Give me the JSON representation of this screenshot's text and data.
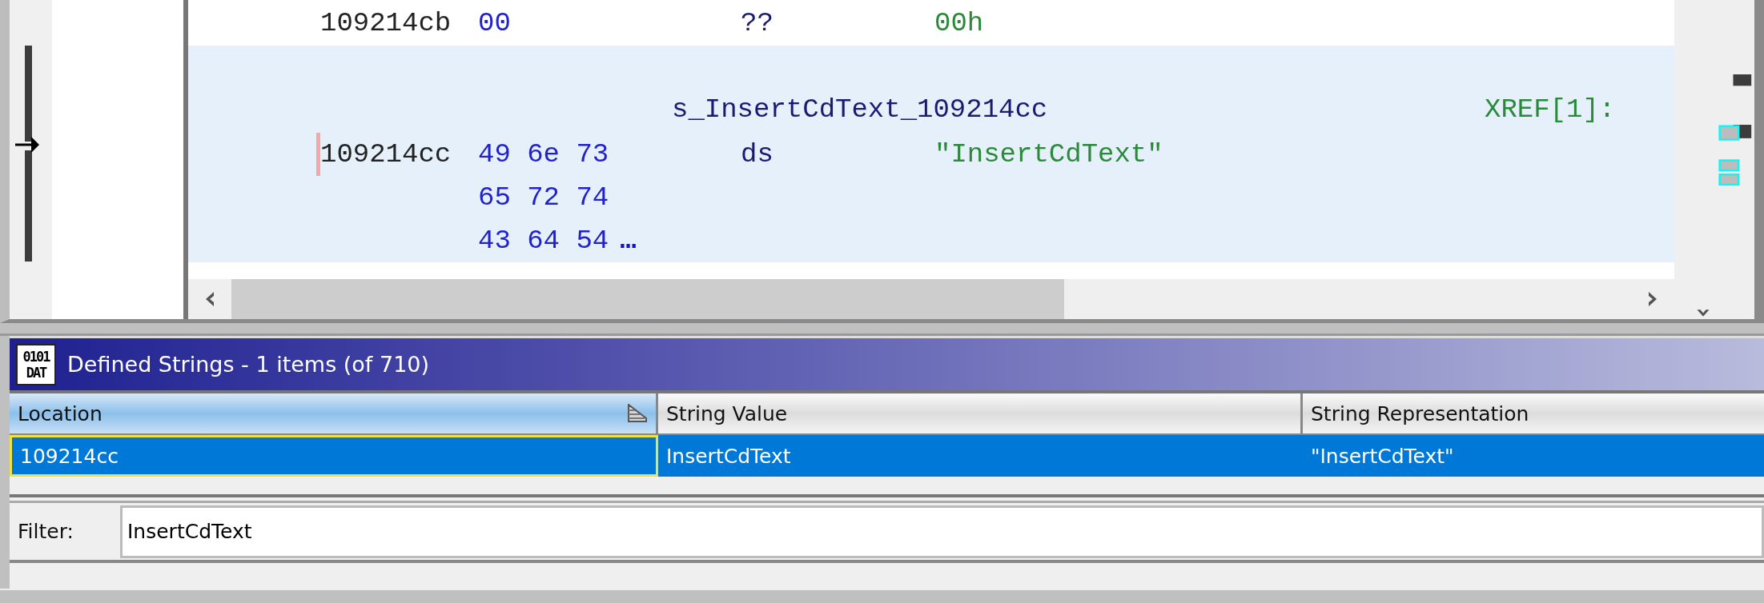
{
  "listing": {
    "rows": [
      {
        "kind": "code",
        "highlighted": false,
        "address": "109214cb",
        "bytes": "00",
        "mnemonic": "??",
        "operand": "00h"
      },
      {
        "kind": "label",
        "highlighted": true,
        "label": "s_InsertCdText_109214cc",
        "xref": "XREF[1]:"
      },
      {
        "kind": "code",
        "highlighted": true,
        "cursor": true,
        "address": "109214cc",
        "bytes": "49 6e 73",
        "mnemonic": "ds",
        "operand": "\"InsertCdText\""
      },
      {
        "kind": "bytes",
        "highlighted": true,
        "bytes": "65 72 74"
      },
      {
        "kind": "bytes",
        "highlighted": true,
        "bytes": "43 64 54",
        "more": "…"
      }
    ]
  },
  "panel": {
    "icon_lines": [
      "0101",
      "DAT"
    ],
    "title": "Defined Strings - 1 items (of 710)",
    "table": {
      "columns": [
        {
          "label": "Location",
          "sorted": true
        },
        {
          "label": "String Value",
          "sorted": false
        },
        {
          "label": "String Representation",
          "sorted": false
        }
      ],
      "rows": [
        {
          "selected": true,
          "cells": [
            "109214cc",
            "InsertCdText",
            "\"InsertCdText\""
          ]
        }
      ]
    },
    "filter": {
      "label": "Filter:",
      "value": "InsertCdText"
    }
  }
}
